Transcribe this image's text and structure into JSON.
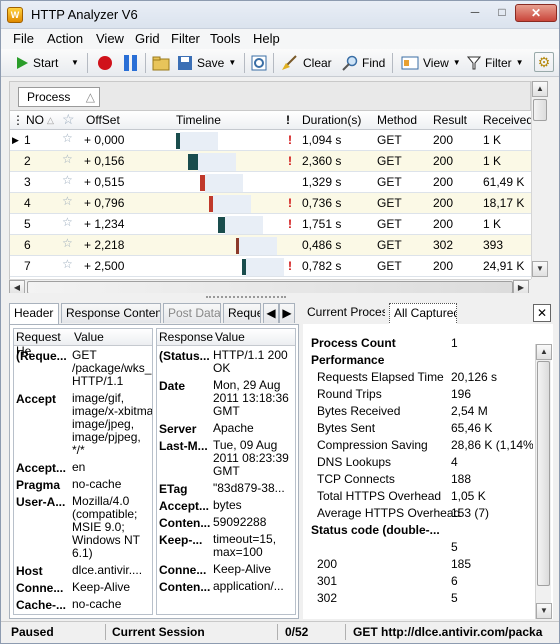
{
  "window": {
    "title": "HTTP Analyzer V6",
    "icon_text": "W"
  },
  "menu": [
    "File",
    "Action",
    "View",
    "Grid",
    "Filter",
    "Tools",
    "Help"
  ],
  "toolbar": {
    "start": "Start",
    "save": "Save",
    "clear": "Clear",
    "find": "Find",
    "view": "View",
    "filter": "Filter"
  },
  "group_chip": "Process",
  "grid": {
    "columns": [
      "NO",
      "OffSet",
      "Timeline",
      "!",
      "Duration(s)",
      "Method",
      "Result",
      "Received"
    ],
    "rows": [
      {
        "no": "1",
        "offset": "+ 0,000",
        "alert": true,
        "duration": "1,094 s",
        "method": "GET",
        "result": "200",
        "received": "1 K",
        "bar_color": "#1a4d4d",
        "bar_start": 0,
        "bar_len": 0.006
      },
      {
        "no": "2",
        "offset": "+ 0,156",
        "alert": true,
        "duration": "2,360 s",
        "method": "GET",
        "result": "200",
        "received": "1 K",
        "bar_color": "#1a4d4d",
        "bar_start": 0.004,
        "bar_len": 0.016
      },
      {
        "no": "3",
        "offset": "+ 0,515",
        "alert": false,
        "duration": "1,329 s",
        "method": "GET",
        "result": "200",
        "received": "61,49 K",
        "bar_color": "#c0392b",
        "bar_start": 0.008,
        "bar_len": 0.009
      },
      {
        "no": "4",
        "offset": "+ 0,796",
        "alert": true,
        "duration": "0,736 s",
        "method": "GET",
        "result": "200",
        "received": "18,17 K",
        "bar_color": "#c0392b",
        "bar_start": 0.011,
        "bar_len": 0.006
      },
      {
        "no": "5",
        "offset": "+ 1,234",
        "alert": true,
        "duration": "1,751 s",
        "method": "GET",
        "result": "200",
        "received": "1 K",
        "bar_color": "#1a4d4d",
        "bar_start": 0.014,
        "bar_len": 0.011
      },
      {
        "no": "6",
        "offset": "+ 2,218",
        "alert": false,
        "duration": "0,486 s",
        "method": "GET",
        "result": "302",
        "received": "393",
        "bar_color": "#8c3a2a",
        "bar_start": 0.02,
        "bar_len": 0.004
      },
      {
        "no": "7",
        "offset": "+ 2,500",
        "alert": true,
        "duration": "0,782 s",
        "method": "GET",
        "result": "200",
        "received": "24,91 K",
        "bar_color": "#1a4d4d",
        "bar_start": 0.022,
        "bar_len": 0.006
      }
    ]
  },
  "left_tabs": [
    "Header",
    "Response Content",
    "Post Data",
    "Reque"
  ],
  "request_headers": {
    "columns": [
      "Request He",
      "Value"
    ],
    "entries": [
      {
        "key": "(Reque...",
        "value": "GET\n/package/wks_\nHTTP/1.1"
      },
      {
        "key": "Accept",
        "value": "image/gif,\nimage/x-xbitma\nimage/jpeg,\nimage/pjpeg,\n*/*"
      },
      {
        "key": "Accept...",
        "value": "en"
      },
      {
        "key": "Pragma",
        "value": "no-cache"
      },
      {
        "key": "User-A...",
        "value": "Mozilla/4.0\n(compatible;\nMSIE 9.0;\nWindows NT\n6.1)"
      },
      {
        "key": "Host",
        "value": "dlce.antivir...."
      },
      {
        "key": "Conne...",
        "value": "Keep-Alive"
      },
      {
        "key": "Cache-...",
        "value": "no-cache"
      }
    ]
  },
  "response_headers": {
    "columns": [
      "Response",
      "Value"
    ],
    "entries": [
      {
        "key": "(Status...",
        "value": "HTTP/1.1 200\nOK"
      },
      {
        "key": "Date",
        "value": "Mon, 29 Aug\n2011 13:18:36\nGMT"
      },
      {
        "key": "Server",
        "value": "Apache"
      },
      {
        "key": "Last-M...",
        "value": "Tue, 09 Aug\n2011 08:23:39\nGMT"
      },
      {
        "key": "ETag",
        "value": "\"83d879-38..."
      },
      {
        "key": "Accept...",
        "value": "bytes"
      },
      {
        "key": "Conten...",
        "value": "59092288"
      },
      {
        "key": "Keep-...",
        "value": "timeout=15,\nmax=100"
      },
      {
        "key": "Conne...",
        "value": "Keep-Alive"
      },
      {
        "key": "Conten...",
        "value": "application/..."
      }
    ]
  },
  "right_tabs": [
    "Current Process",
    "All Captured"
  ],
  "stats": [
    {
      "label": "Process Count",
      "value": "1",
      "kind": "section"
    },
    {
      "label": "Performance",
      "value": "",
      "kind": "section"
    },
    {
      "label": "Requests Elapsed Time",
      "value": "20,126 s",
      "kind": "item"
    },
    {
      "label": "Round Trips",
      "value": "196",
      "kind": "item"
    },
    {
      "label": "Bytes Received",
      "value": "2,54 M",
      "kind": "item"
    },
    {
      "label": "Bytes Sent",
      "value": "65,46 K",
      "kind": "item"
    },
    {
      "label": "Compression Saving",
      "value": "28,86 K (1,14%)",
      "kind": "item"
    },
    {
      "label": "DNS Lookups",
      "value": "4",
      "kind": "item"
    },
    {
      "label": "TCP Connects",
      "value": "188",
      "kind": "item"
    },
    {
      "label": "Total HTTPS Overhead",
      "value": "1,05 K",
      "kind": "item"
    },
    {
      "label": "Average HTTPS Overhead",
      "value": "153  (7)",
      "kind": "item"
    },
    {
      "label": "Status code (double-...",
      "value": "",
      "kind": "section"
    },
    {
      "label": "",
      "value": "5",
      "kind": "item"
    },
    {
      "label": "200",
      "value": "185",
      "kind": "item"
    },
    {
      "label": "301",
      "value": "6",
      "kind": "item"
    },
    {
      "label": "302",
      "value": "5",
      "kind": "item"
    }
  ],
  "status": {
    "state": "Paused",
    "session": "Current Session",
    "count": "0/52",
    "request": "GET  http://dlce.antivir.com/packa"
  }
}
